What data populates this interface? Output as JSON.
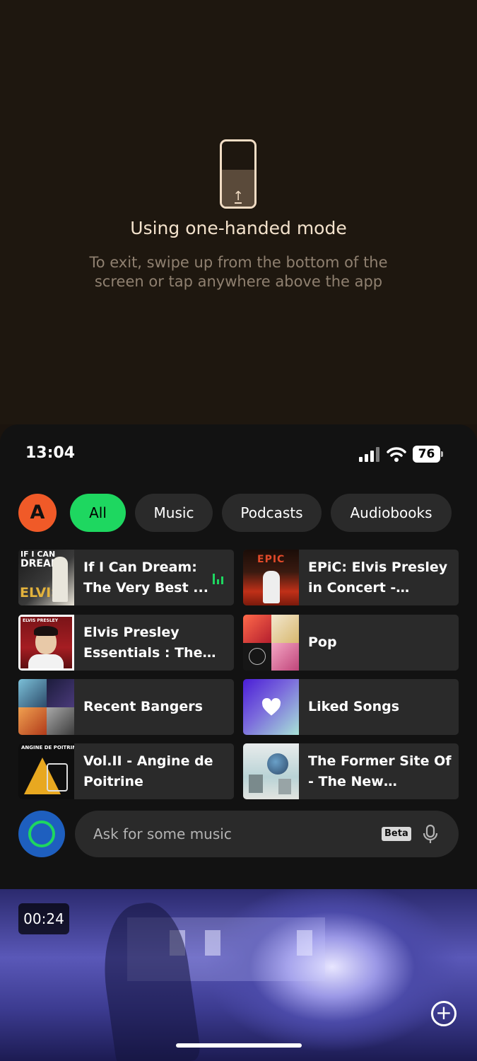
{
  "overlay": {
    "icon": "one-handed-mode-phone-icon",
    "title": "Using one-handed mode",
    "description": "To exit, swipe up from the bottom of the screen or tap anywhere above the app"
  },
  "status_bar": {
    "time": "13:04",
    "battery": "76",
    "icons": [
      "cell-signal-icon",
      "wifi-icon",
      "battery-icon"
    ]
  },
  "filters": {
    "avatar_letter": "A",
    "chips": [
      "All",
      "Music",
      "Podcasts",
      "Audiobooks"
    ],
    "active": "All"
  },
  "shortcuts": [
    {
      "title": "If I Can Dream: The Very Best ...",
      "playing": true
    },
    {
      "title": "EPiC: Elvis Presley in Concert - Original ...",
      "playing": false
    },
    {
      "title": "Elvis Presley Essentials : The Ki...",
      "playing": false
    },
    {
      "title": "Pop",
      "playing": false
    },
    {
      "title": "Recent Bangers",
      "playing": false
    },
    {
      "title": "Liked Songs",
      "playing": false
    },
    {
      "title": "Vol.II - Angine de Poitrine",
      "playing": false
    },
    {
      "title": "The Former Site Of - The New Pornogra...",
      "playing": false
    }
  ],
  "cover_text": {
    "if_i_can_dream": [
      "IF I CAN",
      "DREAM",
      "ELVIS"
    ],
    "epic": "EPIC",
    "elvis_essentials": "ELVIS PRESLEY",
    "angine": "ANGINE DE POITRINE"
  },
  "ask": {
    "placeholder": "Ask for some music",
    "badge": "Beta"
  },
  "video": {
    "timecode": "00:24"
  },
  "colors": {
    "accent": "#1ed760",
    "avatar": "#f05a28",
    "overlay_bg": "#1e170f"
  }
}
